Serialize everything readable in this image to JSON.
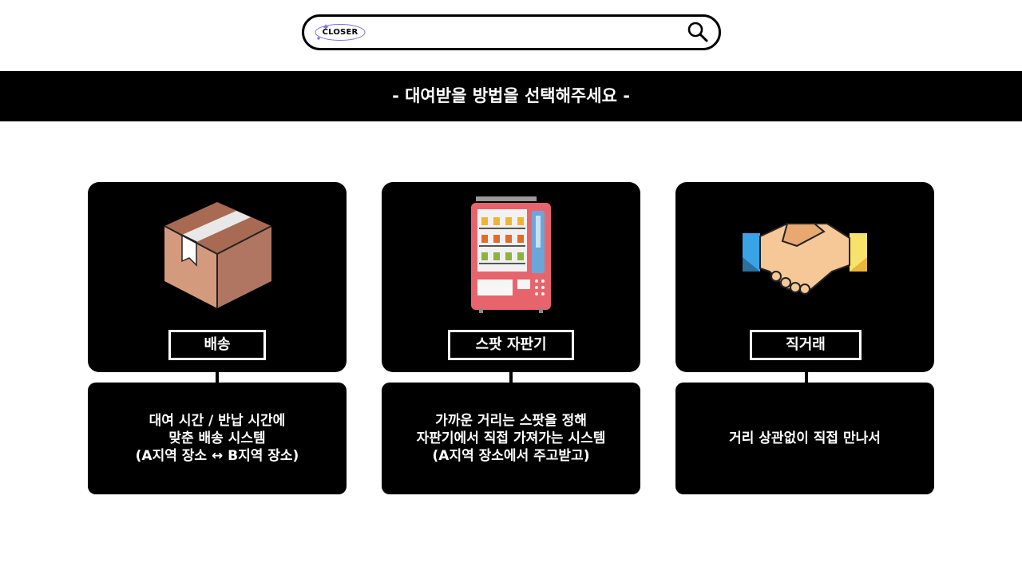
{
  "header": {
    "logo_text": "CLOSER",
    "search_placeholder": "",
    "search_icon": "search-icon"
  },
  "banner": {
    "title": "- 대여받을 방법을 선택해주세요 -"
  },
  "options": [
    {
      "label": "배송",
      "icon": "package-box-icon",
      "description": [
        "대여 시간 / 반납 시간에",
        "맞춘 배송 시스템",
        "(A지역 장소 ↔ B지역 장소)"
      ]
    },
    {
      "label": "스팟 자판기",
      "icon": "vending-machine-icon",
      "description": [
        "가까운 거리는 스팟을 정해",
        "자판기에서 직접 가져가는 시스템",
        "(A지역 장소에서 주고받고)"
      ]
    },
    {
      "label": "직거래",
      "icon": "handshake-icon",
      "description": [
        "거리 상관없이 직접 만나서"
      ]
    }
  ]
}
